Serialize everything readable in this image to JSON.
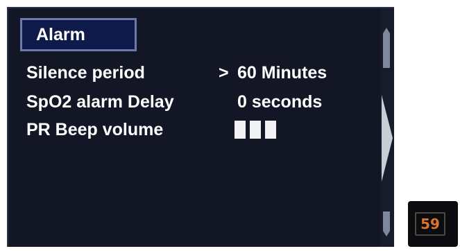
{
  "tab": {
    "label": "Alarm"
  },
  "settings": [
    {
      "label": "Silence period",
      "value": "60  Minutes",
      "selected": true
    },
    {
      "label": "SpO2 alarm Delay",
      "value": "0 seconds",
      "selected": false
    },
    {
      "label": "PR Beep volume",
      "value": "",
      "volume_level": 3,
      "selected": false
    }
  ],
  "selection_marker": ">",
  "badge": {
    "value": "59"
  },
  "icons": {
    "scroll_up": "scroll-up-arrow-icon",
    "scroll_down": "scroll-down-arrow-icon",
    "scroll_indicator": "scroll-indicator-icon"
  },
  "colors": {
    "screen_background": "#121625",
    "tab_background": "#0d1a4a",
    "tab_border": "#6b7aa8",
    "text": "#ffffff",
    "badge_text": "#e0732a"
  }
}
